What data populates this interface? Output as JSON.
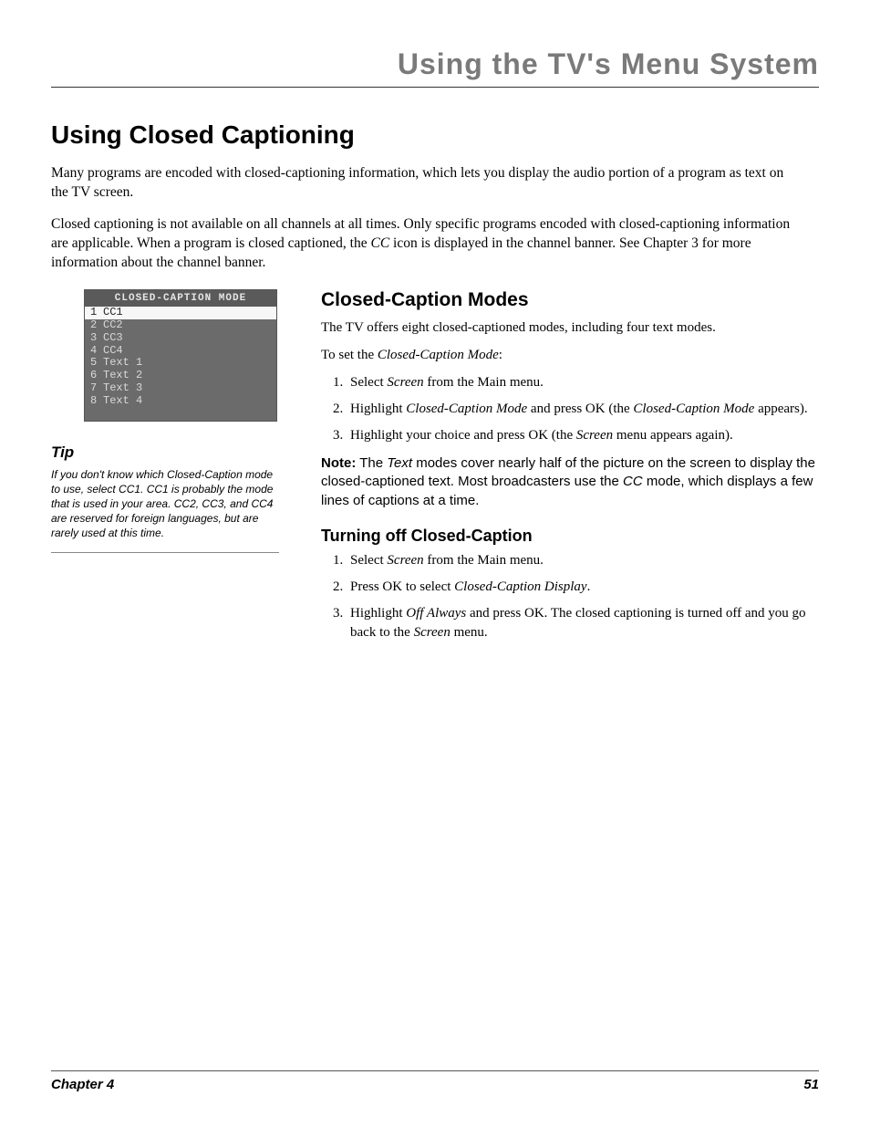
{
  "runningHead": "Using the TV's Menu System",
  "h1": "Using Closed Captioning",
  "intro1_a": "Many programs are encoded with closed-captioning information, which lets you display the audio portion of a program as text on the TV screen.",
  "intro2_a": "Closed captioning is not available on all channels at all times. Only specific programs encoded with closed-captioning information are applicable. When a program is closed captioned, the ",
  "intro2_cc": "CC",
  "intro2_b": " icon is displayed in the channel banner. See Chapter 3 for more information about the channel banner.",
  "ccMenu": {
    "title": "CLOSED-CAPTION MODE",
    "rows": [
      {
        "n": "1",
        "label": "CC1",
        "selected": true
      },
      {
        "n": "2",
        "label": "CC2",
        "selected": false
      },
      {
        "n": "3",
        "label": "CC3",
        "selected": false
      },
      {
        "n": "4",
        "label": "CC4",
        "selected": false
      },
      {
        "n": "5",
        "label": "Text 1",
        "selected": false
      },
      {
        "n": "6",
        "label": "Text 2",
        "selected": false
      },
      {
        "n": "7",
        "label": "Text 3",
        "selected": false
      },
      {
        "n": "8",
        "label": "Text 4",
        "selected": false
      }
    ]
  },
  "tip": {
    "heading": "Tip",
    "body": "If you don't know which Closed-Caption mode to use, select CC1. CC1 is probably the mode that is used in your area. CC2, CC3, and CC4  are reserved for foreign languages, but are rarely used at this time."
  },
  "modes": {
    "heading": "Closed-Caption Modes",
    "p1": "The TV offers eight closed-captioned modes, including four text modes.",
    "p2_a": "To set the ",
    "p2_i": "Closed-Caption Mode",
    "p2_b": ":",
    "steps": {
      "s1_a": "Select ",
      "s1_i": "Screen",
      "s1_b": " from the Main menu.",
      "s2_a": "Highlight ",
      "s2_i1": "Closed-Caption Mode",
      "s2_b": " and press OK  (the ",
      "s2_i2": "Closed-Caption Mode",
      "s2_c": " appears).",
      "s3_a": "Highlight your choice and press OK (the ",
      "s3_i": "Screen",
      "s3_b": " menu appears again)."
    },
    "note_label": "Note:",
    "note_a": " The ",
    "note_i1": "Text",
    "note_b": " modes cover nearly half of the picture on the screen to display the closed-captioned text. Most broadcasters use the ",
    "note_i2": "CC",
    "note_c": " mode, which displays a few lines of captions at a time."
  },
  "turnoff": {
    "heading": "Turning off Closed-Caption",
    "steps": {
      "s1_a": "Select ",
      "s1_i": "Screen",
      "s1_b": " from the Main menu.",
      "s2_a": "Press OK to select ",
      "s2_i": "Closed-Caption Display",
      "s2_b": ".",
      "s3_a": "Highlight ",
      "s3_i": "Off Always",
      "s3_b": " and press OK. The closed captioning is turned off and you go back to the ",
      "s3_i2": "Screen",
      "s3_c": " menu."
    }
  },
  "footer": {
    "left": "Chapter 4",
    "right": "51"
  }
}
